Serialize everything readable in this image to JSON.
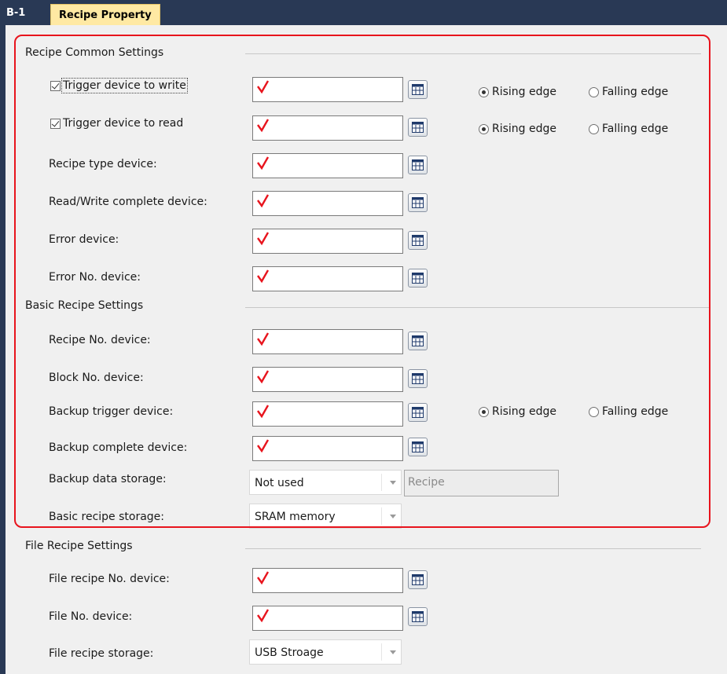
{
  "tabs": {
    "id": "B-1",
    "active": "Recipe Property"
  },
  "sections": {
    "common": "Recipe Common Settings",
    "basic": "Basic Recipe Settings",
    "file": "File Recipe Settings"
  },
  "fields": {
    "trigger_write": "Trigger device to write",
    "trigger_read": "Trigger device to read",
    "recipe_type": "Recipe type device:",
    "rw_complete": "Read/Write complete device:",
    "error_device": "Error device:",
    "error_no": "Error No. device:",
    "recipe_no": "Recipe No. device:",
    "block_no": "Block No. device:",
    "backup_trigger": "Backup trigger device:",
    "backup_complete": "Backup complete device:",
    "backup_storage": "Backup data storage:",
    "basic_storage": "Basic recipe storage:",
    "file_recipe_no": "File recipe No. device:",
    "file_no": "File No. device:",
    "file_storage": "File recipe storage:"
  },
  "checkboxes": {
    "trigger_write": true,
    "trigger_read": true
  },
  "radio": {
    "rising": "Rising edge",
    "falling": "Falling edge",
    "selected": "rising"
  },
  "values": {
    "backup_storage": "Not used",
    "backup_recipe_placeholder": "Recipe",
    "basic_storage": "SRAM memory",
    "file_storage": "USB Stroage"
  },
  "icons": {
    "device_button": "device-browse-icon",
    "required_mark": "red-check-icon"
  },
  "colors": {
    "titlebar": "#293955",
    "active_tab": "#ffe9a3",
    "highlight_frame": "#e8141d",
    "check_mark": "#e8141d"
  }
}
